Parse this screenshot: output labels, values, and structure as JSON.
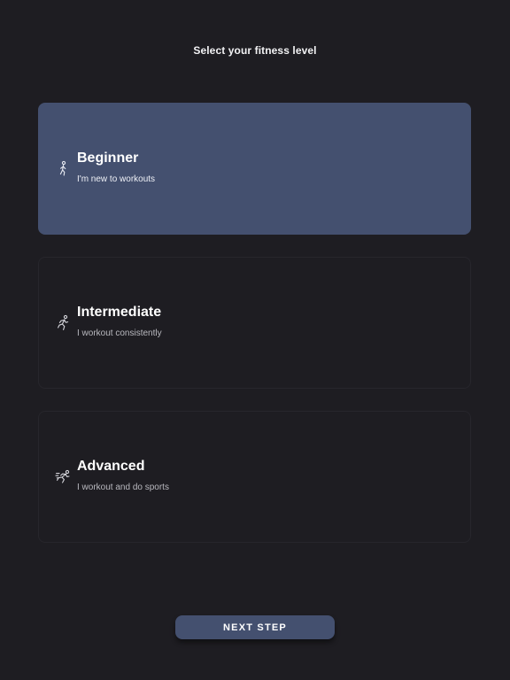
{
  "header": {
    "title": "Select your fitness level"
  },
  "levels": [
    {
      "title": "Beginner",
      "subtitle": "I'm new to workouts",
      "icon": "walking-person-icon",
      "selected": true
    },
    {
      "title": "Intermediate",
      "subtitle": "I workout consistently",
      "icon": "running-person-icon",
      "selected": false
    },
    {
      "title": "Advanced",
      "subtitle": "I workout and do sports",
      "icon": "sprinting-person-icon",
      "selected": false
    }
  ],
  "footer": {
    "next_label": "NEXT STEP"
  },
  "colors": {
    "background": "#1e1d22",
    "accent": "#44506f",
    "card_border": "#27262c"
  }
}
